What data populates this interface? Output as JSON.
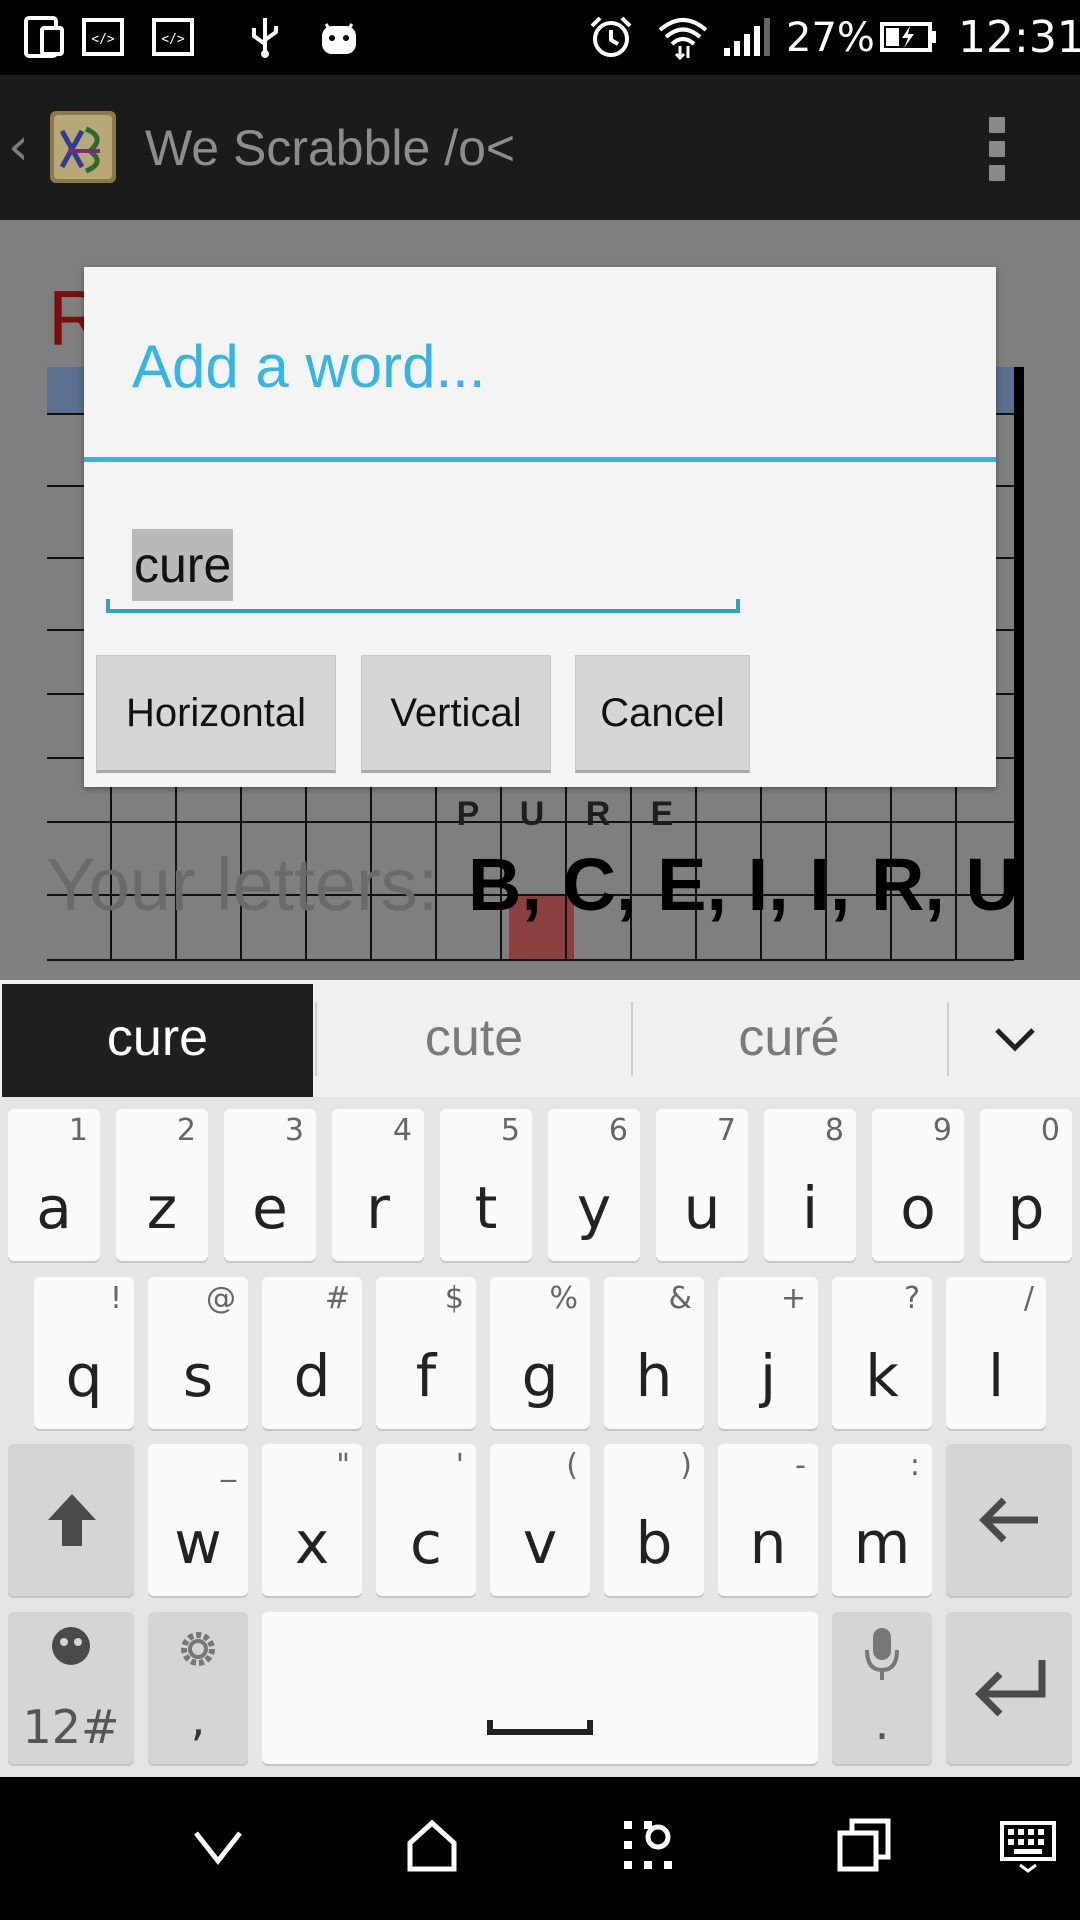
{
  "status_bar": {
    "battery_percent": "27%",
    "time": "12:31"
  },
  "action_bar": {
    "title": "We Scrabble /o<"
  },
  "board": {
    "score_partial": "R",
    "tiles": [
      "P",
      "U",
      "R",
      "E"
    ],
    "letters_label": "Your letters: ",
    "letters_value": "B, C, E, I, I, R, U"
  },
  "dialog": {
    "title": "Add a word...",
    "input_value": "cure",
    "buttons": {
      "horizontal": "Horizontal",
      "vertical": "Vertical",
      "cancel": "Cancel"
    }
  },
  "keyboard": {
    "suggestions": [
      "cure",
      "cute",
      "curé"
    ],
    "row1": [
      {
        "key": "a",
        "hint": "1"
      },
      {
        "key": "z",
        "hint": "2"
      },
      {
        "key": "e",
        "hint": "3"
      },
      {
        "key": "r",
        "hint": "4"
      },
      {
        "key": "t",
        "hint": "5"
      },
      {
        "key": "y",
        "hint": "6"
      },
      {
        "key": "u",
        "hint": "7"
      },
      {
        "key": "i",
        "hint": "8"
      },
      {
        "key": "o",
        "hint": "9"
      },
      {
        "key": "p",
        "hint": "0"
      }
    ],
    "row2": [
      {
        "key": "q",
        "hint": "!"
      },
      {
        "key": "s",
        "hint": "@"
      },
      {
        "key": "d",
        "hint": "#"
      },
      {
        "key": "f",
        "hint": "$"
      },
      {
        "key": "g",
        "hint": "%"
      },
      {
        "key": "h",
        "hint": "&"
      },
      {
        "key": "j",
        "hint": "+"
      },
      {
        "key": "k",
        "hint": "?"
      },
      {
        "key": "l",
        "hint": "/"
      }
    ],
    "row3": [
      {
        "key": "w",
        "hint": "_"
      },
      {
        "key": "x",
        "hint": "\""
      },
      {
        "key": "c",
        "hint": "'"
      },
      {
        "key": "v",
        "hint": "("
      },
      {
        "key": "b",
        "hint": ")"
      },
      {
        "key": "n",
        "hint": "-"
      },
      {
        "key": "m",
        "hint": ":"
      }
    ],
    "symbols_label": "12#",
    "comma": ",",
    "period": "."
  }
}
